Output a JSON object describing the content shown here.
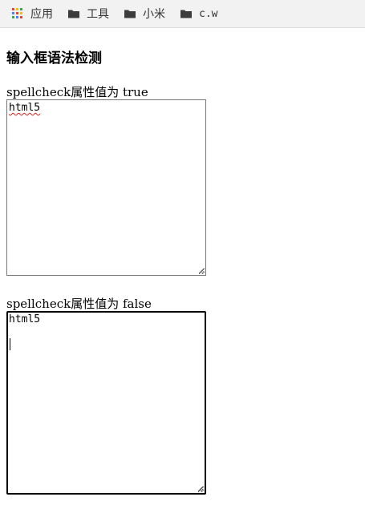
{
  "bookmarks": [
    {
      "label": "应用",
      "icon": "apps-grid-icon"
    },
    {
      "label": "工具",
      "icon": "folder-icon"
    },
    {
      "label": "小米",
      "icon": "folder-icon"
    },
    {
      "label": "c.w",
      "icon": "folder-icon"
    }
  ],
  "page": {
    "title": "输入框语法检测"
  },
  "fields": [
    {
      "label": "spellcheck属性值为 true",
      "value": "html5",
      "spellcheck": true,
      "focused": false
    },
    {
      "label": "spellcheck属性值为 false",
      "value": "html5",
      "spellcheck": false,
      "focused": true
    }
  ],
  "colors": {
    "bookmarks_bg": "#f2f2f2",
    "spell_error_underline": "#e0201a",
    "focus_border": "#000000",
    "folder_icon": "#3c3c3c"
  }
}
